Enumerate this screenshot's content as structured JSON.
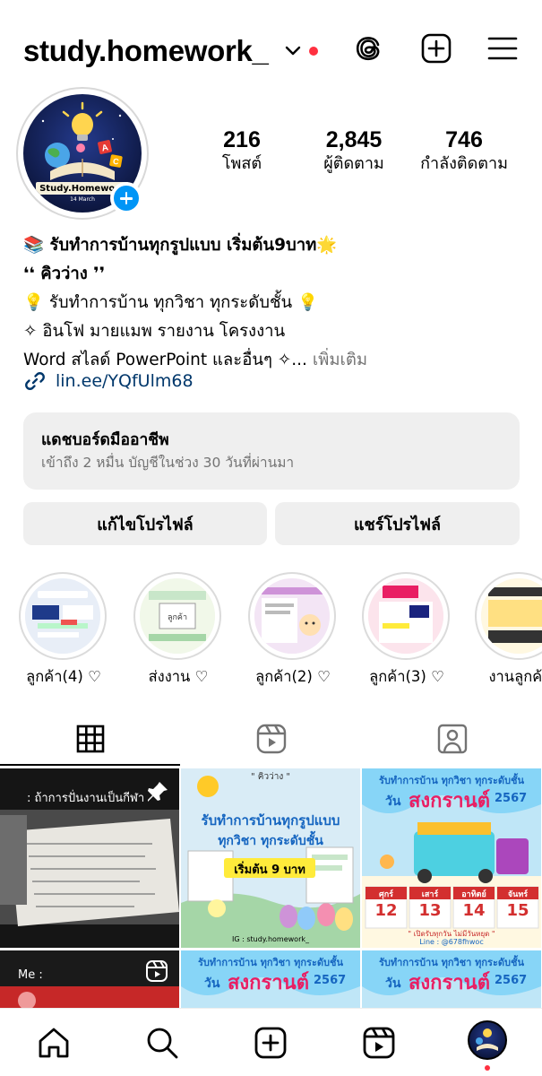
{
  "header": {
    "username": "study.homework_"
  },
  "avatar": {
    "caption": "Study.Homework",
    "subcaption": "14 March"
  },
  "stats": [
    {
      "value": "216",
      "label": "โพสต์"
    },
    {
      "value": "2,845",
      "label": "ผู้ติดตาม"
    },
    {
      "value": "746",
      "label": "กำลังติดตาม"
    }
  ],
  "bio": {
    "line1": "📚 รับทำการบ้านทุกรูปแบบ เริ่มต้น9บาท🌟",
    "line2": "❛❛ คิวว่าง ❜❜",
    "line3": "💡 รับทำการบ้าน ทุกวิชา ทุกระดับชั้น 💡",
    "line4": "✧ อินโฟ มายแมพ รายงาน โครงงาน",
    "line5": "Word สไลด์ PowerPoint และอื่นๆ ✧...",
    "more": "เพิ่มเติม",
    "link": "lin.ee/YQfUlm68"
  },
  "dashboard": {
    "title": "แดชบอร์ดมืออาชีพ",
    "subtitle": "เข้าถึง 2 หมื่น บัญชีในช่วง 30 วันที่ผ่านมา"
  },
  "buttons": {
    "edit": "แก้ไขโปรไฟล์",
    "share": "แชร์โปรไฟล์"
  },
  "highlights": [
    {
      "label": "ลูกค้า(4) ♡"
    },
    {
      "label": "ส่งงาน ♡"
    },
    {
      "label": "ลูกค้า(2) ♡"
    },
    {
      "label": "ลูกค้า(3) ♡"
    },
    {
      "label": "งานลูกค้า"
    }
  ],
  "posts": {
    "p1_text": ": ถ้าการปั่นงานเป็นกีฬา",
    "p2_tag": "\" คิวว่าง \"",
    "p2_title1": "รับทำการบ้านทุกรูปแบบ",
    "p2_title2": "ทุกวิชา ทุกระดับชั้น",
    "p2_price": "เริ่มต้น 9 บาท",
    "p2_ig": "IG : study.homework_",
    "p3_title": "รับทำการบ้าน ทุกวิชา ทุกระดับชั้น",
    "p3_day": "วัน",
    "p3_song": "สงกรานต์",
    "p3_year": "2567",
    "p3_days": [
      {
        "name": "ศุกร์",
        "num": "12"
      },
      {
        "name": "เสาร์",
        "num": "13"
      },
      {
        "name": "อาทิตย์",
        "num": "14"
      },
      {
        "name": "จันทร์",
        "num": "15"
      }
    ],
    "p3_open": "\" เปิดรับทุกวัน ไม่มีวันหยุด \"",
    "p3_line": "Line : @678fhwoc",
    "p4_text": "Me :",
    "p5_title": "รับทำการบ้าน ทุกวิชา ทุกระดับชั้น",
    "p5_day": "วัน",
    "p5_song": "สงกรานต์",
    "p5_year": "2567"
  },
  "colors": {
    "accent": "#0095f6",
    "link": "#00376b",
    "notification": "#ff3040",
    "button_bg": "#efefef",
    "muted": "#737373"
  },
  "icons": [
    "chevron-down-icon",
    "threads-icon",
    "new-post-icon",
    "menu-icon",
    "link-icon",
    "grid-icon",
    "reels-icon",
    "tagged-icon",
    "home-icon",
    "search-icon",
    "create-icon",
    "reels-nav-icon",
    "pin-icon"
  ]
}
